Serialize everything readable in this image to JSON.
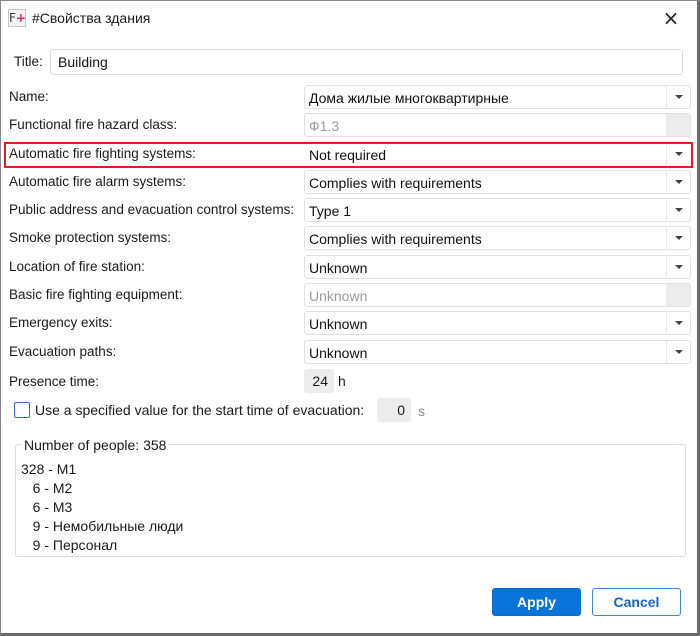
{
  "window": {
    "app_icon": "F+",
    "title": "#Свойства здания",
    "close_icon": "×"
  },
  "title_field": {
    "label": "Title:",
    "value": "Building"
  },
  "properties": [
    {
      "label": "Name:",
      "value": "Дома жилые многоквартирные",
      "enabled": true
    },
    {
      "label": "Functional fire hazard class:",
      "value": "Ф1.3",
      "enabled": false
    },
    {
      "label": "Automatic fire fighting systems:",
      "value": "Not required",
      "enabled": true,
      "highlighted": true
    },
    {
      "label": "Automatic fire alarm systems:",
      "value": "Complies with requirements",
      "enabled": true
    },
    {
      "label": "Public address and evacuation control systems:",
      "value": "Type 1",
      "enabled": true
    },
    {
      "label": "Smoke protection systems:",
      "value": "Complies with requirements",
      "enabled": true
    },
    {
      "label": "Location of fire station:",
      "value": "Unknown",
      "enabled": true
    },
    {
      "label": "Basic fire fighting equipment:",
      "value": "Unknown",
      "enabled": false
    },
    {
      "label": "Emergency exits:",
      "value": "Unknown",
      "enabled": true
    },
    {
      "label": "Evacuation paths:",
      "value": "Unknown",
      "enabled": true
    }
  ],
  "presence_time": {
    "label": "Presence time:",
    "value": "24",
    "unit": "h"
  },
  "evacuation_start": {
    "label": "Use a specified value for the start time of evacuation:",
    "checked": false,
    "value": "0",
    "unit": "s"
  },
  "people": {
    "legend": "Number of people: 358",
    "items": [
      "328 - М1",
      "   6 - М2",
      "   6 - М3",
      "   9 - Немобильные люди",
      "   9 - Персонал"
    ]
  },
  "buttons": {
    "apply": "Apply",
    "cancel": "Cancel"
  },
  "colors": {
    "highlight": "#e31b23",
    "accent": "#0a74da"
  }
}
